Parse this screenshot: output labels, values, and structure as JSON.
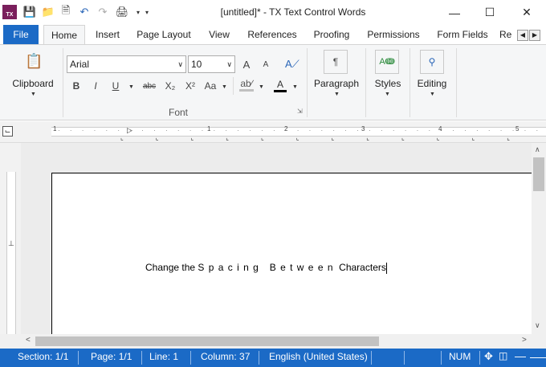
{
  "title": "[untitled]* - TX Text Control Words",
  "tabs": [
    "File",
    "Home",
    "Insert",
    "Page Layout",
    "View",
    "References",
    "Proofing",
    "Permissions",
    "Form Fields",
    "Re"
  ],
  "ribbon": {
    "clipboard_label": "Clipboard",
    "font_name": "Arial",
    "font_size": "10",
    "font_group_label": "Font",
    "paragraph_label": "Paragraph",
    "styles_label": "Styles",
    "editing_label": "Editing",
    "bold": "B",
    "italic": "I",
    "underline": "U",
    "strike": "abc",
    "sub": "X₂",
    "sup": "X²",
    "case": "Aa",
    "grow": "A",
    "shrink": "A"
  },
  "ruler_numbers": [
    "1",
    "1",
    "2",
    "3",
    "4",
    "5"
  ],
  "document": {
    "text_plain": "Change the",
    "text_spaced": "S p a c i n g   B e t w e e n",
    "text_end": "Characters"
  },
  "status": {
    "section": "Section: 1/1",
    "page": "Page: 1/1",
    "line": "Line: 1",
    "column": "Column: 37",
    "language": "English (United States)",
    "num": "NUM"
  },
  "colors": {
    "accent": "#1b6ac6"
  }
}
